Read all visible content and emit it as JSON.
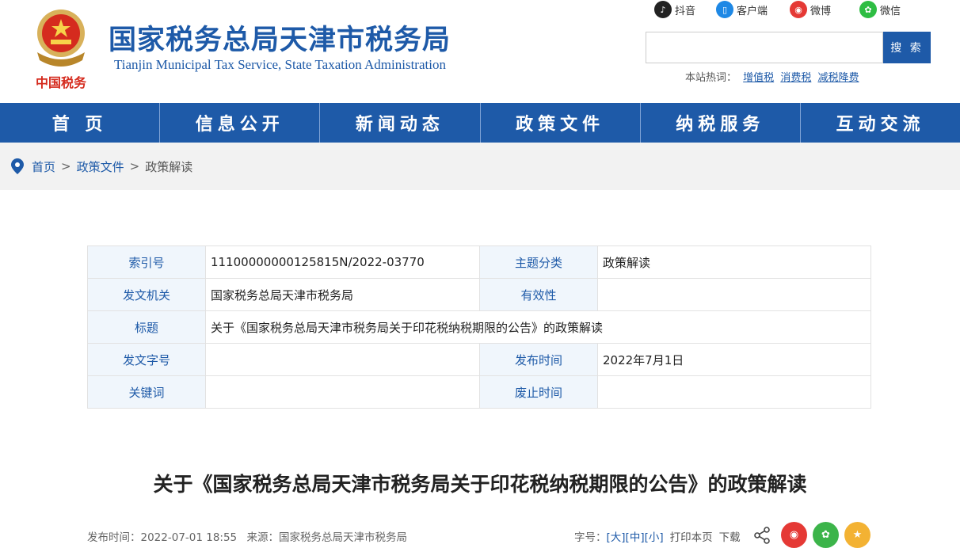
{
  "header": {
    "title": "国家税务总局天津市税务局",
    "subtitle": "Tianjin Municipal Tax Service, State Taxation Administration",
    "emblem_caption": "中国税务",
    "social": [
      {
        "label": "抖音",
        "icon": "douyin-icon"
      },
      {
        "label": "客户端",
        "icon": "mobile-app-icon"
      },
      {
        "label": "微博",
        "icon": "weibo-icon"
      },
      {
        "label": "微信",
        "icon": "wechat-icon"
      }
    ],
    "search": {
      "placeholder": "",
      "button": "搜 索"
    },
    "hotwords": {
      "label": "本站热词：",
      "items": [
        "增值税",
        "消费税",
        "减税降费"
      ]
    },
    "colors": {
      "brand": "#1e5aa8",
      "info_key_bg": "#f0f6fc",
      "crumb_bg": "#f2f2f2"
    }
  },
  "nav": [
    "首 页",
    "信息公开",
    "新闻动态",
    "政策文件",
    "纳税服务",
    "互动交流"
  ],
  "breadcrumb": {
    "items": [
      "首页",
      "政策文件"
    ],
    "sep": ">",
    "current": "政策解读"
  },
  "info": {
    "rows": [
      [
        "索引号",
        "11100000000125815N/2022-03770",
        "主题分类",
        "政策解读"
      ],
      [
        "发文机关",
        "国家税务总局天津市税务局",
        "有效性",
        ""
      ],
      [
        "标题",
        "关于《国家税务总局天津市税务局关于印花税纳税期限的公告》的政策解读"
      ],
      [
        "发文字号",
        "",
        "发布时间",
        "2022年7月1日"
      ],
      [
        "关键词",
        "",
        "废止时间",
        ""
      ]
    ]
  },
  "article": {
    "title": "关于《国家税务总局天津市税务局关于印花税纳税期限的公告》的政策解读",
    "publish_time": "发布时间：2022-07-01 18:55",
    "source": "来源：国家税务总局天津市税务局",
    "font_size_label": "字号：",
    "sizes": [
      "[大]",
      "[中]",
      "[小]"
    ],
    "print": "打印本页",
    "download": "下载"
  }
}
